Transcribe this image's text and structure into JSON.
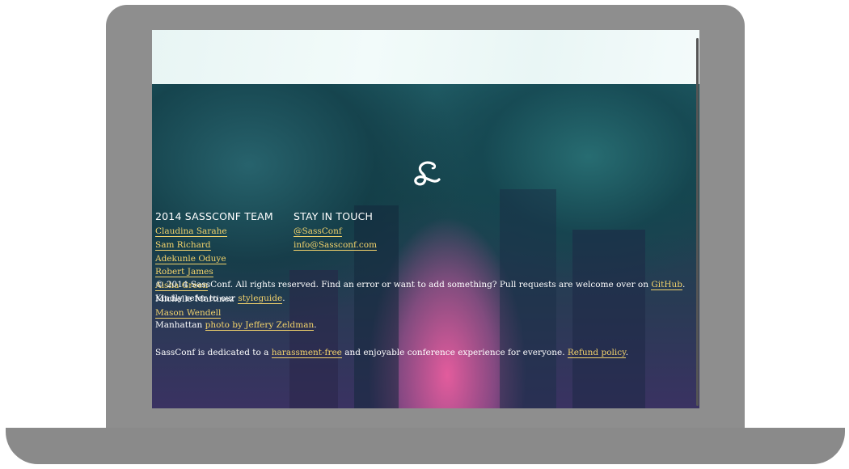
{
  "colors": {
    "link": "#f3d36b",
    "text": "#ffffff",
    "device": "#8e8e8e"
  },
  "logo": {
    "letter": "S",
    "icon": "sassconf-logo"
  },
  "team": {
    "heading": "2014 SASSCONF TEAM",
    "members": [
      {
        "name": "Claudina Sarahe",
        "link": true
      },
      {
        "name": "Sam Richard",
        "link": true
      },
      {
        "name": "Adekunle Oduye",
        "link": true
      },
      {
        "name": "Robert James",
        "link": true
      },
      {
        "name": "Aisha Green",
        "link": true
      },
      {
        "name": "Michelle Martinez",
        "link": false
      },
      {
        "name": "Mason Wendell",
        "link": true
      }
    ]
  },
  "touch": {
    "heading": "STAY IN TOUCH",
    "twitter": "@SassConf",
    "email": "info@Sassconf.com"
  },
  "footer": {
    "copyright_prefix": "© 2014 SassConf. All rights reserved. Find an error or want to add something? Pull requests are welcome over on ",
    "github_link": "GitHub",
    "copyright_middle": ". Kindly refer to our ",
    "styleguide_link": "styleguide",
    "copyright_end": ".",
    "photo_prefix": "Manhattan ",
    "photo_link": "photo by Jeffery Zeldman",
    "photo_end": ".",
    "policy_prefix": "SassConf is dedicated to a ",
    "harassment_link": "harassment-free",
    "policy_middle": " and enjoyable conference experience for everyone. ",
    "refund_link": "Refund policy",
    "policy_end": "."
  }
}
